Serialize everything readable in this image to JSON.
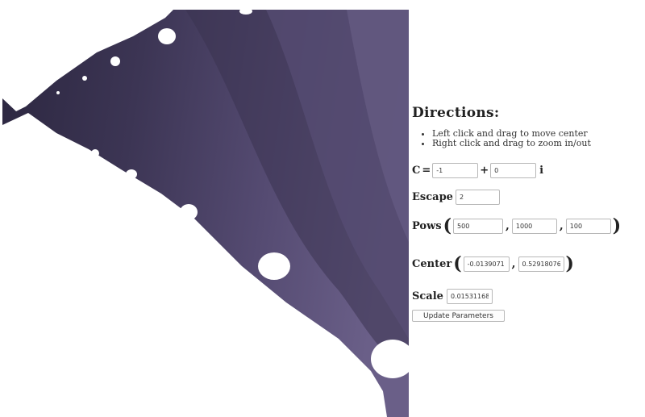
{
  "directions": {
    "title": "Directions:",
    "items": [
      "Left click and drag to move center",
      "Right click and drag to zoom in/out"
    ]
  },
  "params": {
    "c": {
      "label": "C",
      "eq": "=",
      "real": "-1",
      "plus": "+",
      "imag": "0",
      "i": "i"
    },
    "escape": {
      "label": "Escape",
      "value": "2"
    },
    "pows": {
      "label": "Pows",
      "open": "(",
      "sep": ",",
      "close": ")",
      "values": [
        "500",
        "1000",
        "100"
      ]
    },
    "center": {
      "label": "Center",
      "open": "(",
      "sep": ",",
      "close": ")",
      "values": [
        "-0.0139071",
        "0.52918076"
      ]
    },
    "scale": {
      "label": "Scale",
      "value": "0.01531168"
    }
  },
  "update_button": "Update Parameters",
  "colors": {
    "fractal_dark": "#2e2940",
    "fractal_light": "#6a5f88"
  }
}
